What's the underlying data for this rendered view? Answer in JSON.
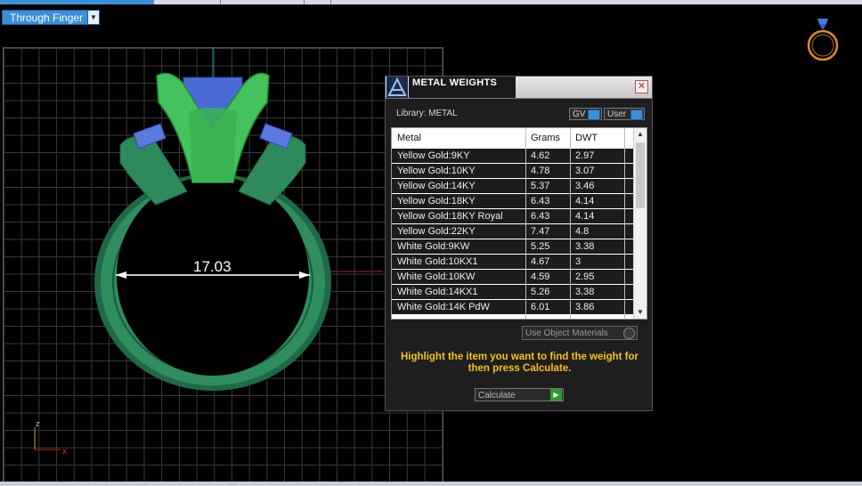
{
  "view": {
    "mode_label": "Through Finger",
    "dimension": "17.03",
    "axis_z": "z",
    "axis_x": "x"
  },
  "panel": {
    "title": "METAL WEIGHTS",
    "library_label": "Library: METAL",
    "toggles": [
      {
        "label": "GV"
      },
      {
        "label": "User"
      }
    ],
    "columns": [
      "Metal",
      "Grams",
      "DWT"
    ],
    "rows": [
      {
        "metal": "Yellow Gold:9KY",
        "grams": "4.62",
        "dwt": "2.97"
      },
      {
        "metal": "Yellow Gold:10KY",
        "grams": "4.78",
        "dwt": "3.07"
      },
      {
        "metal": "Yellow Gold:14KY",
        "grams": "5.37",
        "dwt": "3.46"
      },
      {
        "metal": "Yellow Gold:18KY",
        "grams": "6.43",
        "dwt": "4.14"
      },
      {
        "metal": "Yellow Gold:18KY Royal",
        "grams": "6.43",
        "dwt": "4.14"
      },
      {
        "metal": "Yellow Gold:22KY",
        "grams": "7.47",
        "dwt": "4.8"
      },
      {
        "metal": "White Gold:9KW",
        "grams": "5.25",
        "dwt": "3.38"
      },
      {
        "metal": "White Gold:10KX1",
        "grams": "4.67",
        "dwt": "3"
      },
      {
        "metal": "White Gold:10KW",
        "grams": "4.59",
        "dwt": "2.95"
      },
      {
        "metal": "White Gold:14KX1",
        "grams": "5.26",
        "dwt": "3.38"
      },
      {
        "metal": "White Gold:14K PdW",
        "grams": "6.01",
        "dwt": "3.86"
      }
    ],
    "use_object_materials_label": "Use Object Materials",
    "hint": "Highlight the item you want to find the weight for then press Calculate.",
    "calculate_label": "Calculate"
  },
  "colors": {
    "accent": "#3a8fd8",
    "hint": "#f4c21a",
    "ring": "#2e8a5a",
    "prong": "#3fbf5a",
    "gem": "#3f5fcf"
  },
  "icons": {
    "close": "close-icon",
    "logo": "app-logo-icon",
    "view": "ring-view-icon"
  }
}
